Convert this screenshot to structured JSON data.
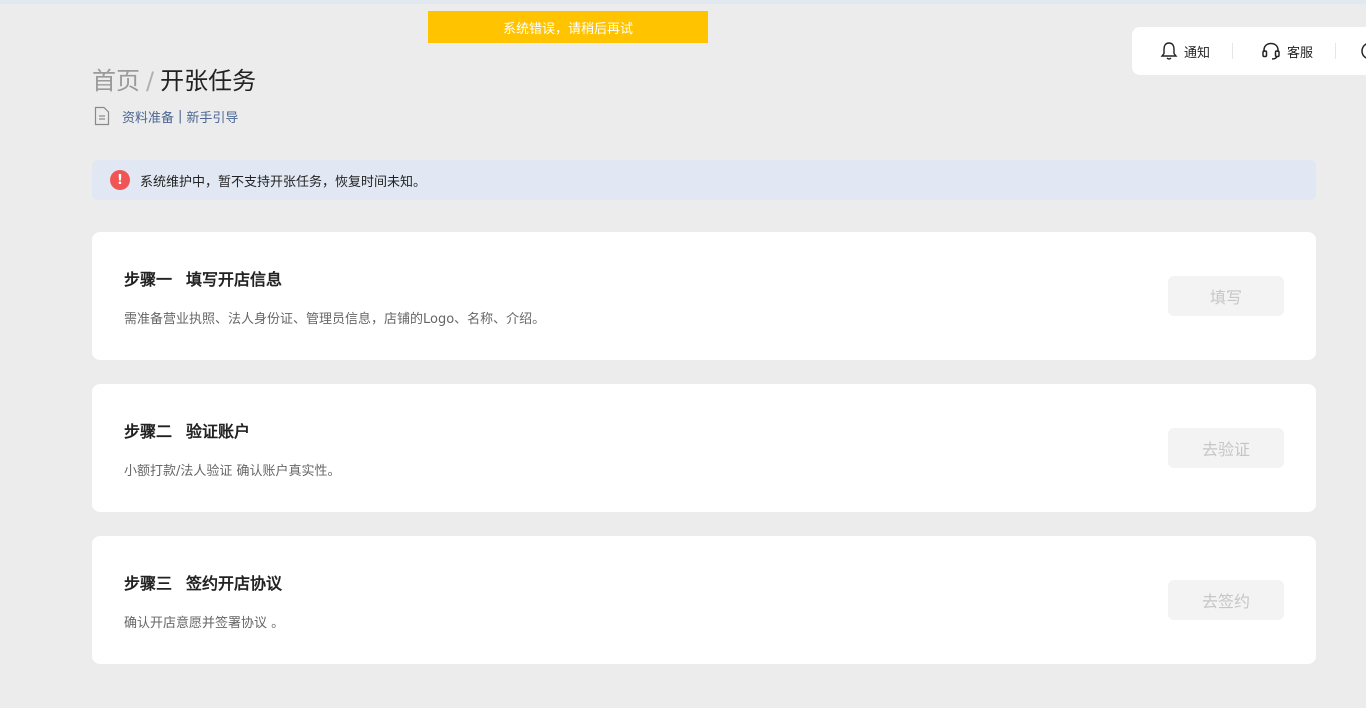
{
  "toast": {
    "text": "系统错误，请稍后再试"
  },
  "top_actions": {
    "notify_label": "通知",
    "service_label": "客服"
  },
  "breadcrumb": {
    "home": "首页",
    "separator": "/",
    "current": "开张任务"
  },
  "guide_links": {
    "prepare": "资料准备",
    "divider": "|",
    "newbie": "新手引导"
  },
  "alert": {
    "icon": "!",
    "text": "系统维护中，暂不支持开张任务，恢复时间未知。"
  },
  "steps": [
    {
      "step_no": "步骤一",
      "title": "填写开店信息",
      "desc": "需准备营业执照、法人身份证、管理员信息，店铺的Logo、名称、介绍。",
      "button": "填写"
    },
    {
      "step_no": "步骤二",
      "title": "验证账户",
      "desc": "小额打款/法人验证 确认账户真实性。",
      "button": "去验证"
    },
    {
      "step_no": "步骤三",
      "title": "签约开店协议",
      "desc": "确认开店意愿并签署协议 。",
      "button": "去签约"
    }
  ],
  "colors": {
    "toast_bg": "#ffc300",
    "alert_bg": "#e1e8f3",
    "alert_icon": "#f05454",
    "link": "#4a6694",
    "page_bg": "#ececec"
  }
}
